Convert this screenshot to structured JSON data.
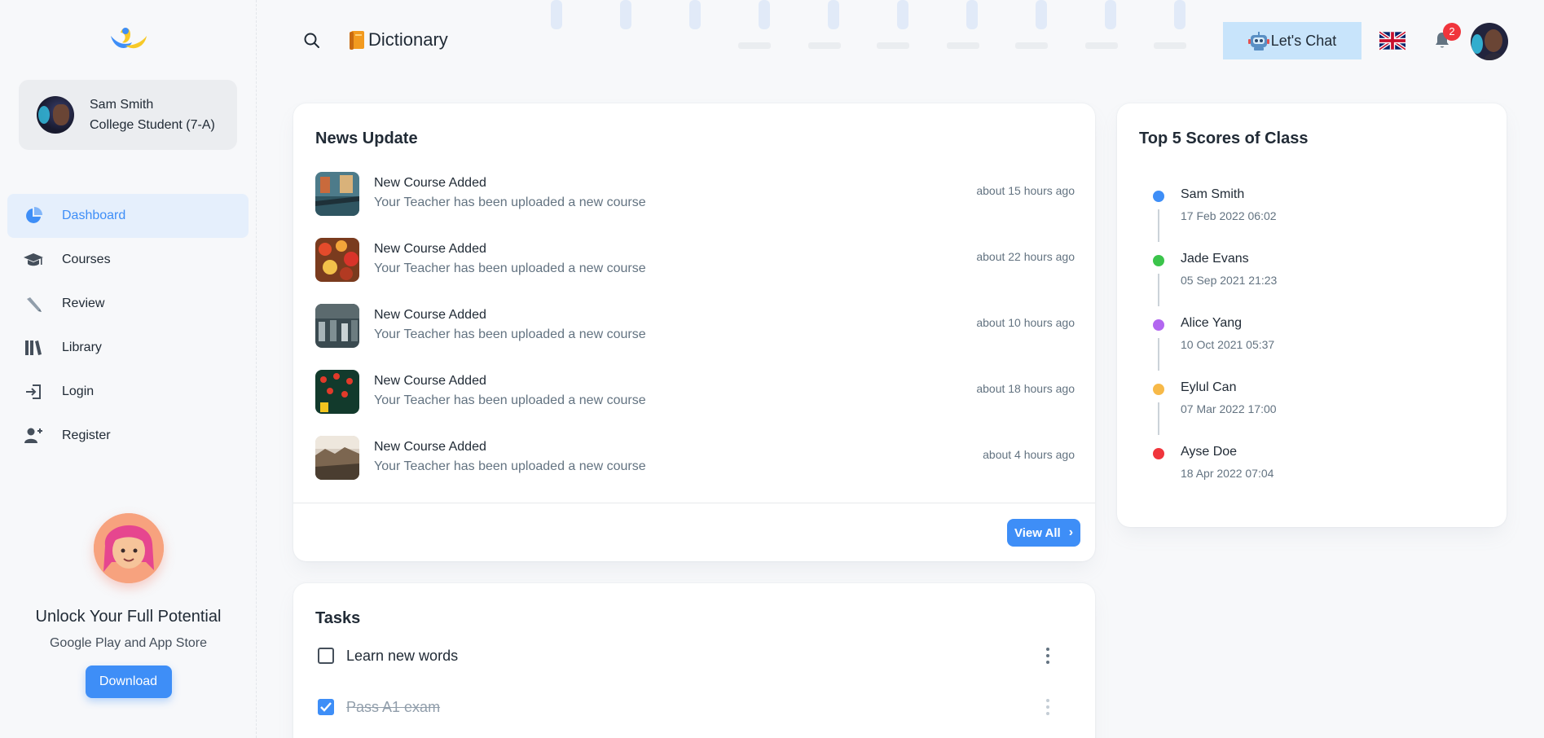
{
  "profile": {
    "name": "Sam Smith",
    "role": "College Student (7-A)"
  },
  "nav": {
    "items": [
      {
        "label": "Dashboard",
        "icon": "pie-chart-icon",
        "active": true
      },
      {
        "label": "Courses",
        "icon": "graduation-cap-icon"
      },
      {
        "label": "Review",
        "icon": "pencil-icon"
      },
      {
        "label": "Library",
        "icon": "books-icon"
      },
      {
        "label": "Login",
        "icon": "login-icon"
      },
      {
        "label": "Register",
        "icon": "add-user-icon"
      }
    ]
  },
  "promo": {
    "title": "Unlock Your Full Potential",
    "subtitle": "Google Play and App Store",
    "button": "Download"
  },
  "topbar": {
    "title": "Dictionary",
    "chat_label": "Let's Chat",
    "notification_count": "2"
  },
  "news": {
    "title": "News Update",
    "items": [
      {
        "title": "New Course Added",
        "desc": "Your Teacher has been uploaded a new course",
        "time": "about 15 hours ago"
      },
      {
        "title": "New Course Added",
        "desc": "Your Teacher has been uploaded a new course",
        "time": "about 22 hours ago"
      },
      {
        "title": "New Course Added",
        "desc": "Your Teacher has been uploaded a new course",
        "time": "about 10 hours ago"
      },
      {
        "title": "New Course Added",
        "desc": "Your Teacher has been uploaded a new course",
        "time": "about 18 hours ago"
      },
      {
        "title": "New Course Added",
        "desc": "Your Teacher has been uploaded a new course",
        "time": "about 4 hours ago"
      }
    ],
    "view_all": "View All"
  },
  "scores": {
    "title": "Top 5 Scores of Class",
    "items": [
      {
        "name": "Sam Smith",
        "date": "17 Feb 2022 06:02",
        "color": "#3e8ef7"
      },
      {
        "name": "Jade Evans",
        "date": "05 Sep 2021 21:23",
        "color": "#3bc44b"
      },
      {
        "name": "Alice Yang",
        "date": "10 Oct 2021 05:37",
        "color": "#b266f0"
      },
      {
        "name": "Eylul Can",
        "date": "07 Mar 2022 17:00",
        "color": "#f7b948"
      },
      {
        "name": "Ayse Doe",
        "date": "18 Apr 2022 07:04",
        "color": "#f0353c"
      }
    ]
  },
  "tasks": {
    "title": "Tasks",
    "items": [
      {
        "label": "Learn new words",
        "done": false
      },
      {
        "label": "Pass A1 exam",
        "done": true
      }
    ]
  },
  "colors": {
    "accent": "#3e8ef7",
    "active_bg": "#e5effc",
    "chat_bg": "#c8e4fb",
    "badge": "#f0353c"
  }
}
